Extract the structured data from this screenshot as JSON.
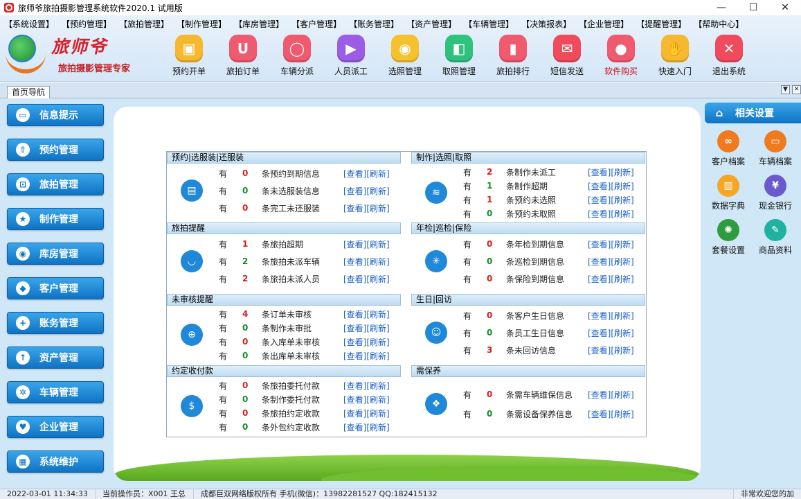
{
  "window": {
    "title": "旅师爷旅拍摄影管理系统软件2020.1 试用版",
    "controls": [
      "—",
      "☐",
      "✕"
    ]
  },
  "menu": [
    "【系统设置】",
    "【预约管理】",
    "【旅拍管理】",
    "【制作管理】",
    "【库房管理】",
    "【客户管理】",
    "【账务管理】",
    "【资产管理】",
    "【车辆管理】",
    "【决策报表】",
    "【企业管理】",
    "【提醒管理】",
    "【帮助中心】"
  ],
  "logo": {
    "name": "旅师爷",
    "slogan": "旅拍摄影管理专家"
  },
  "toolbar": [
    {
      "label": "预约开单",
      "color": "#f5b82e",
      "icon": "calendar-icon",
      "glyph": "▣"
    },
    {
      "label": "旅拍订单",
      "color": "#f05a6e",
      "icon": "bag-icon",
      "glyph": "U"
    },
    {
      "label": "车辆分派",
      "color": "#f05a6e",
      "icon": "balloon-icon",
      "glyph": "◯"
    },
    {
      "label": "人员派工",
      "color": "#9b5de5",
      "icon": "play-icon",
      "glyph": "▶"
    },
    {
      "label": "选照管理",
      "color": "#f5c22e",
      "icon": "shield-icon",
      "glyph": "◉"
    },
    {
      "label": "取照管理",
      "color": "#2ec27e",
      "icon": "box-icon",
      "glyph": "◧"
    },
    {
      "label": "旅拍排行",
      "color": "#f05a6e",
      "icon": "bar-chart-icon",
      "glyph": "▮"
    },
    {
      "label": "短信发送",
      "color": "#ef4b5c",
      "icon": "message-icon",
      "glyph": "✉"
    },
    {
      "label": "软件购买",
      "color": "#f05a6e",
      "icon": "location-pin-icon",
      "glyph": "●",
      "red": true
    },
    {
      "label": "快速入门",
      "color": "#f5b82e",
      "icon": "hand-icon",
      "glyph": "✋"
    },
    {
      "label": "退出系统",
      "color": "#ef4b5c",
      "icon": "exit-icon",
      "glyph": "✕"
    }
  ],
  "tab": {
    "label": "首页导航",
    "pin": "▼",
    "close": "✕"
  },
  "leftnav": [
    {
      "label": "信息提示",
      "icon": "monitor-icon",
      "glyph": "▭"
    },
    {
      "label": "预约管理",
      "icon": "upload-icon",
      "glyph": "⇧"
    },
    {
      "label": "旅拍管理",
      "icon": "cart-icon",
      "glyph": "⊡"
    },
    {
      "label": "制作管理",
      "icon": "star-icon",
      "glyph": "★"
    },
    {
      "label": "库房管理",
      "icon": "eye-icon",
      "glyph": "◉"
    },
    {
      "label": "客户管理",
      "icon": "tag-icon",
      "glyph": "◆"
    },
    {
      "label": "账务管理",
      "icon": "plus-circle-icon",
      "glyph": "+"
    },
    {
      "label": "资产管理",
      "icon": "upload-tray-icon",
      "glyph": "↑"
    },
    {
      "label": "车辆管理",
      "icon": "wheel-icon",
      "glyph": "✲"
    },
    {
      "label": "企业管理",
      "icon": "heart-icon",
      "glyph": "♥"
    },
    {
      "label": "系统维护",
      "icon": "grid-icon",
      "glyph": "▦"
    }
  ],
  "status_colors": {
    "red": "#d21f1f",
    "green": "#148c2a"
  },
  "sections": [
    {
      "title": "预约|选服装|还服装",
      "icon": "clipboard-icon",
      "glyph": "▤",
      "rows": [
        {
          "you": "有",
          "num": "0",
          "color": "red",
          "text": "条预约到期信息",
          "view": "[查看]",
          "refresh": "[刷新]"
        },
        {
          "you": "有",
          "num": "0",
          "color": "green",
          "text": "条未选服装信息",
          "view": "[查看]",
          "refresh": "[刷新]"
        },
        {
          "you": "有",
          "num": "0",
          "color": "red",
          "text": "条完工未还服装",
          "view": "[查看]",
          "refresh": "[刷新]"
        }
      ]
    },
    {
      "title": "制作|选照|取照",
      "icon": "layers-icon",
      "glyph": "≋",
      "rows": [
        {
          "you": "有",
          "num": "2",
          "color": "red",
          "text": "条制作未派工",
          "view": "[查看]",
          "refresh": "[刷新]"
        },
        {
          "you": "有",
          "num": "1",
          "color": "green",
          "text": "条制作超期",
          "view": "[查看]",
          "refresh": "[刷新]"
        },
        {
          "you": "有",
          "num": "1",
          "color": "red",
          "text": "条预约未选照",
          "view": "[查看]",
          "refresh": "[刷新]"
        },
        {
          "you": "有",
          "num": "0",
          "color": "green",
          "text": "条预约未取照",
          "view": "[查看]",
          "refresh": "[刷新]"
        }
      ]
    },
    {
      "title": "旅拍提醒",
      "icon": "bag-icon",
      "glyph": "◡",
      "rows": [
        {
          "you": "有",
          "num": "1",
          "color": "red",
          "text": "条旅拍超期",
          "view": "[查看]",
          "refresh": "[刷新]"
        },
        {
          "you": "有",
          "num": "2",
          "color": "green",
          "text": "条旅拍未派车辆",
          "view": "[查看]",
          "refresh": "[刷新]"
        },
        {
          "you": "有",
          "num": "2",
          "color": "red",
          "text": "条旅拍未派人员",
          "view": "[查看]",
          "refresh": "[刷新]"
        }
      ]
    },
    {
      "title": "年检|巡检|保险",
      "icon": "network-icon",
      "glyph": "✳",
      "rows": [
        {
          "you": "有",
          "num": "0",
          "color": "red",
          "text": "条年检到期信息",
          "view": "[查看]",
          "refresh": "[刷新]"
        },
        {
          "you": "有",
          "num": "0",
          "color": "green",
          "text": "条巡检到期信息",
          "view": "[查看]",
          "refresh": "[刷新]"
        },
        {
          "you": "有",
          "num": "0",
          "color": "red",
          "text": "条保险到期信息",
          "view": "[查看]",
          "refresh": "[刷新]"
        }
      ]
    },
    {
      "title": "未审核提醒",
      "icon": "target-icon",
      "glyph": "⊕",
      "rows": [
        {
          "you": "有",
          "num": "4",
          "color": "red",
          "text": "条订单未审核",
          "view": "[查看]",
          "refresh": "[刷新]"
        },
        {
          "you": "有",
          "num": "0",
          "color": "green",
          "text": "条制作未审批",
          "view": "[查看]",
          "refresh": "[刷新]"
        },
        {
          "you": "有",
          "num": "0",
          "color": "red",
          "text": "条入库单未审核",
          "view": "[查看]",
          "refresh": "[刷新]"
        },
        {
          "you": "有",
          "num": "0",
          "color": "green",
          "text": "条出库单未审核",
          "view": "[查看]",
          "refresh": "[刷新]"
        }
      ]
    },
    {
      "title": "生日|回访",
      "icon": "users-icon",
      "glyph": "☺",
      "rows": [
        {
          "you": "有",
          "num": "0",
          "color": "red",
          "text": "条客户生日信息",
          "view": "[查看]",
          "refresh": "[刷新]"
        },
        {
          "you": "有",
          "num": "0",
          "color": "green",
          "text": "条员工生日信息",
          "view": "[查看]",
          "refresh": "[刷新]"
        },
        {
          "you": "有",
          "num": "3",
          "color": "red",
          "text": "条未回访信息",
          "view": "[查看]",
          "refresh": "[刷新]"
        }
      ]
    },
    {
      "title": "约定收付款",
      "icon": "money-bag-icon",
      "glyph": "$",
      "rows": [
        {
          "you": "有",
          "num": "0",
          "color": "red",
          "text": "条旅拍委托付款",
          "view": "[查看]",
          "refresh": "[刷新]"
        },
        {
          "you": "有",
          "num": "0",
          "color": "green",
          "text": "条制作委托付款",
          "view": "[查看]",
          "refresh": "[刷新]"
        },
        {
          "you": "有",
          "num": "0",
          "color": "red",
          "text": "条旅拍约定收款",
          "view": "[查看]",
          "refresh": "[刷新]"
        },
        {
          "you": "有",
          "num": "0",
          "color": "green",
          "text": "条外包约定收款",
          "view": "[查看]",
          "refresh": "[刷新]"
        }
      ]
    },
    {
      "title": "需保养",
      "icon": "apps-icon",
      "glyph": "❖",
      "rows": [
        {
          "you": "有",
          "num": "0",
          "color": "red",
          "text": "条需车辆维保信息",
          "view": "[查看]",
          "refresh": "[刷新]"
        },
        {
          "you": "有",
          "num": "0",
          "color": "green",
          "text": "条需设备保养信息",
          "view": "[查看]",
          "refresh": "[刷新]"
        }
      ]
    }
  ],
  "rightpanel": {
    "title": "相关设置",
    "home_icon": "⌂",
    "items": [
      {
        "label": "客户档案",
        "icon": "link-icon",
        "color": "#f07b1e",
        "glyph": "∞"
      },
      {
        "label": "车辆档案",
        "icon": "monitor-icon",
        "color": "#f07b1e",
        "glyph": "▭"
      },
      {
        "label": "数据字典",
        "icon": "book-icon",
        "color": "#f5a623",
        "glyph": "▥"
      },
      {
        "label": "现金银行",
        "icon": "bank-icon",
        "color": "#6a5acd",
        "glyph": "¥"
      },
      {
        "label": "套餐设置",
        "icon": "gear-icon",
        "color": "#2e9b3f",
        "glyph": "✺"
      },
      {
        "label": "商品资料",
        "icon": "pencil-icon",
        "color": "#20b2a0",
        "glyph": "✎"
      }
    ]
  },
  "status": [
    "2022-03-01 11:34:33",
    "当前操作员：X001 王总",
    "成都巨双网络版权所有 手机(微信)：13982281527 QQ:182415132",
    "非常欢迎您的加"
  ]
}
